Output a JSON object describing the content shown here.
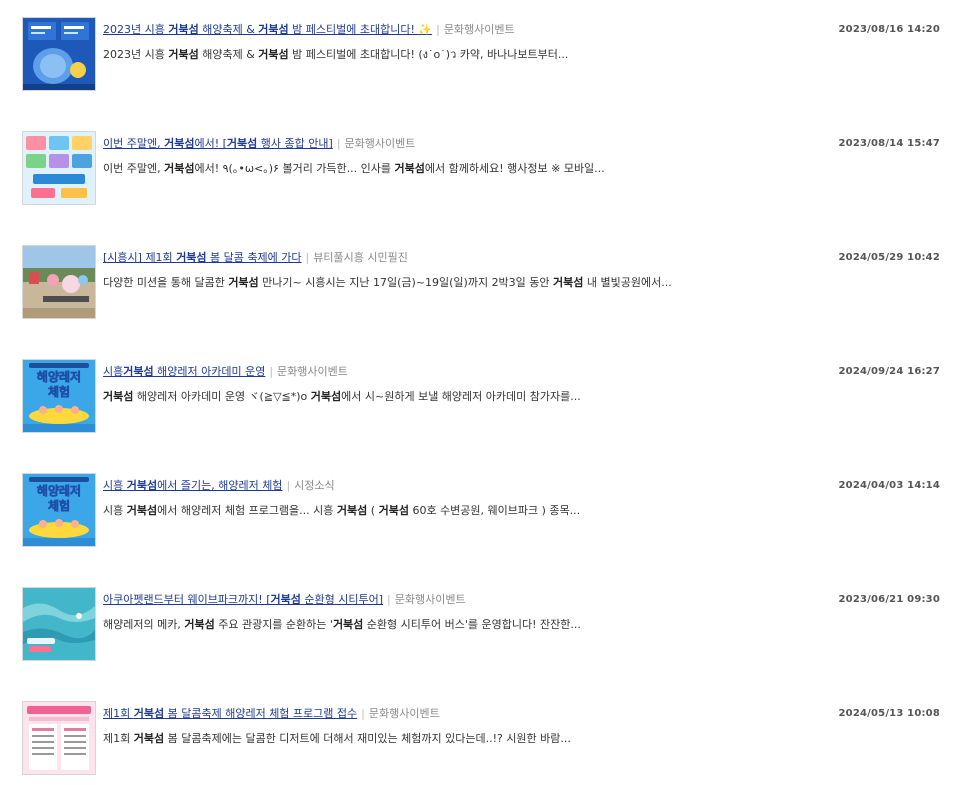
{
  "items": [
    {
      "title": [
        {
          "t": "2023년 시흥 ",
          "b": false
        },
        {
          "t": "거북섬",
          "b": true
        },
        {
          "t": " 해양축제 & ",
          "b": false
        },
        {
          "t": "거북섬",
          "b": true
        },
        {
          "t": " 밤 페스티벌에 초대합니다! ",
          "b": false
        }
      ],
      "title_emoji": "✨",
      "category": "문화행사이벤트",
      "date": "2023/08/16 14:20",
      "desc": [
        {
          "t": "2023년 시흥 ",
          "b": false
        },
        {
          "t": "거북섬",
          "b": true
        },
        {
          "t": " 해양축제 & ",
          "b": false
        },
        {
          "t": "거북섬",
          "b": true
        },
        {
          "t": " 밤 페스티벌에 초대합니다! (ง˙o˙)ว 카약, 바나나보트부터...",
          "b": false
        }
      ],
      "thumb": "festival-poster"
    },
    {
      "title": [
        {
          "t": "이번 주말엔, ",
          "b": false
        },
        {
          "t": "거북섬",
          "b": true
        },
        {
          "t": "에서! [",
          "b": false
        },
        {
          "t": "거북섬",
          "b": true
        },
        {
          "t": " 행사 종합 안내]",
          "b": false
        }
      ],
      "title_emoji": "",
      "category": "문화행사이벤트",
      "date": "2023/08/14 15:47",
      "desc": [
        {
          "t": "이번 주말엔, ",
          "b": false
        },
        {
          "t": "거북섬",
          "b": true
        },
        {
          "t": "에서! ٩(｡•ω<｡)۶ 볼거리 가득한... 인사를 ",
          "b": false
        },
        {
          "t": "거북섬",
          "b": true
        },
        {
          "t": "에서 함께하세요! 행사정보 ※ 모바일...",
          "b": false
        }
      ],
      "thumb": "event-guide"
    },
    {
      "title": [
        {
          "t": "[시흥시] 제1회 ",
          "b": false
        },
        {
          "t": "거북섬",
          "b": true
        },
        {
          "t": " 봄 달콤 축제에 가다",
          "b": false
        }
      ],
      "title_emoji": "",
      "category": "뷰티풀시흥 시민필진",
      "date": "2024/05/29 10:42",
      "desc": [
        {
          "t": "다양한 미션을 통해 달콤한 ",
          "b": false
        },
        {
          "t": "거북섬",
          "b": true
        },
        {
          "t": " 만나기~ 시흥시는 지난 17일(금)~19일(일)까지 2박3일 동안 ",
          "b": false
        },
        {
          "t": "거북섬",
          "b": true
        },
        {
          "t": " 내 별빛공원에서...",
          "b": false
        }
      ],
      "thumb": "park-photo"
    },
    {
      "title": [
        {
          "t": "시흥",
          "b": false
        },
        {
          "t": "거북섬",
          "b": true
        },
        {
          "t": " 해양레저 아카데미 운영",
          "b": false
        }
      ],
      "title_emoji": "",
      "category": "문화행사이벤트",
      "date": "2024/09/24 16:27",
      "desc": [
        {
          "t": "거북섬",
          "b": true
        },
        {
          "t": " 해양레저 아카데미 운영 ヾ(≧▽≦*)o ",
          "b": false
        },
        {
          "t": "거북섬",
          "b": true
        },
        {
          "t": "에서 시~원하게 보낼 해양레저 아카데미 참가자를...",
          "b": false
        }
      ],
      "thumb": "marine-leisure",
      "thumb_text": [
        "해양레저",
        "체험"
      ]
    },
    {
      "title": [
        {
          "t": "시흥 ",
          "b": false
        },
        {
          "t": "거북섬",
          "b": true
        },
        {
          "t": "에서 즐기는, 해양레저 체험",
          "b": false
        }
      ],
      "title_emoji": "",
      "category": "시정소식",
      "date": "2024/04/03 14:14",
      "desc": [
        {
          "t": "시흥 ",
          "b": false
        },
        {
          "t": "거북섬",
          "b": true
        },
        {
          "t": "에서 해양레저 체험 프로그램을... 시흥 ",
          "b": false
        },
        {
          "t": "거북섬",
          "b": true
        },
        {
          "t": " ( ",
          "b": false
        },
        {
          "t": "거북섬",
          "b": true
        },
        {
          "t": " 60호 수변공원, 웨이브파크 ) 종목...",
          "b": false
        }
      ],
      "thumb": "marine-leisure",
      "thumb_text": [
        "해양레저",
        "체험"
      ]
    },
    {
      "title": [
        {
          "t": "아쿠아펫랜드부터 웨이브파크까지! [",
          "b": false
        },
        {
          "t": "거북섬",
          "b": true
        },
        {
          "t": " 순환형 시티투어]",
          "b": false
        }
      ],
      "title_emoji": "",
      "category": "문화행사이벤트",
      "date": "2023/06/21 09:30",
      "desc": [
        {
          "t": "해양레저의 메카, ",
          "b": false
        },
        {
          "t": "거북섬",
          "b": true
        },
        {
          "t": " 주요 관광지를 순환하는 '",
          "b": false
        },
        {
          "t": "거북섬",
          "b": true
        },
        {
          "t": " 순환형 시티투어 버스'를 운영합니다! 잔잔한...",
          "b": false
        }
      ],
      "thumb": "wave-aerial"
    },
    {
      "title": [
        {
          "t": "제1회 ",
          "b": false
        },
        {
          "t": "거북섬",
          "b": true
        },
        {
          "t": " 봄 달콤축제 해양레저 체험 프로그램 접수",
          "b": false
        }
      ],
      "title_emoji": "",
      "category": "문화행사이벤트",
      "date": "2024/05/13 10:08",
      "desc": [
        {
          "t": "제1회 ",
          "b": false
        },
        {
          "t": "거북섬",
          "b": true
        },
        {
          "t": " 봄 달콤축제에는 달콤한 디저트에 더해서 재미있는 체험까지 있다는데..!? 시원한 바람...",
          "b": false
        }
      ],
      "thumb": "pink-table"
    }
  ]
}
